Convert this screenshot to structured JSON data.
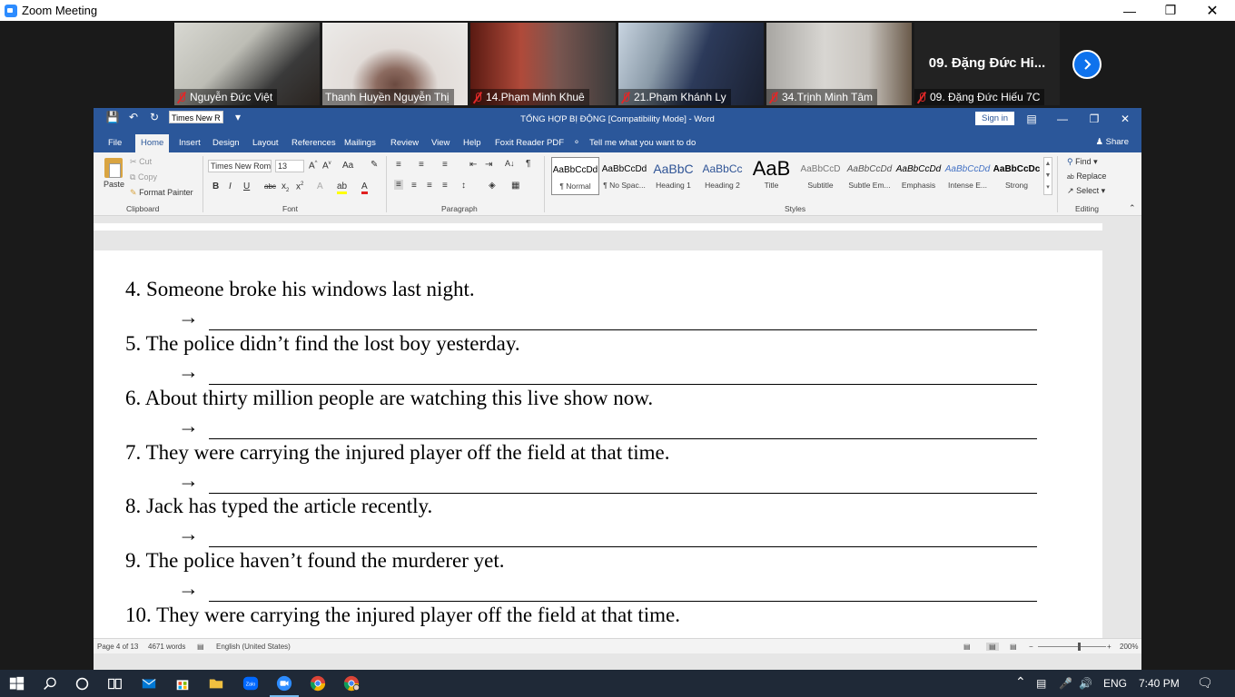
{
  "zoom": {
    "title": "Zoom Meeting",
    "participants": [
      {
        "name": "Nguyễn Đức Việt",
        "muted": true
      },
      {
        "name": "Thanh Huyền Nguyễn Thị",
        "muted": false,
        "active_speaker": true
      },
      {
        "name": "14.Phạm Minh Khuê",
        "muted": true
      },
      {
        "name": "21.Phạm Khánh Ly",
        "muted": true
      },
      {
        "name": "34.Trịnh Minh Tâm",
        "muted": true
      },
      {
        "name": "09. Đặng Đức Hiếu 7C",
        "muted": true,
        "display_name": "09. Đặng Đức Hi..."
      }
    ],
    "next_icon": "chevron-right-icon"
  },
  "word": {
    "qat_font": "Times New R",
    "doc_title": "TỔNG HỢP BỊ ĐỘNG [Compatibility Mode] - Word",
    "sign_in": "Sign in",
    "tabs": [
      "File",
      "Home",
      "Insert",
      "Design",
      "Layout",
      "References",
      "Mailings",
      "Review",
      "View",
      "Help",
      "Foxit Reader PDF"
    ],
    "active_tab": "Home",
    "tell_me": "Tell me what you want to do",
    "share": "Share",
    "clipboard": {
      "paste": "Paste",
      "cut": "Cut",
      "copy": "Copy",
      "format_painter": "Format Painter",
      "label": "Clipboard"
    },
    "font": {
      "name": "Times New Rom",
      "size": "13",
      "label": "Font"
    },
    "paragraph": {
      "label": "Paragraph"
    },
    "styles": {
      "label": "Styles",
      "items": [
        {
          "preview": "AaBbCcDd",
          "name": "¶ Normal"
        },
        {
          "preview": "AaBbCcDd",
          "name": "¶ No Spac..."
        },
        {
          "preview": "AaBbC",
          "name": "Heading 1"
        },
        {
          "preview": "AaBbCc",
          "name": "Heading 2"
        },
        {
          "preview": "AaB",
          "name": "Title"
        },
        {
          "preview": "AaBbCcD",
          "name": "Subtitle"
        },
        {
          "preview": "AaBbCcDd",
          "name": "Subtle Em..."
        },
        {
          "preview": "AaBbCcDd",
          "name": "Emphasis"
        },
        {
          "preview": "AaBbCcDd",
          "name": "Intense E..."
        },
        {
          "preview": "AaBbCcDc",
          "name": "Strong"
        }
      ]
    },
    "editing": {
      "find": "Find",
      "replace": "Replace",
      "select": "Select",
      "label": "Editing"
    },
    "document": {
      "questions": [
        "4. Someone broke his windows last night.",
        "5. The police didn’t find the lost boy yesterday.",
        "6. About thirty million people are watching this live show now.",
        "7. They were carrying the injured player off the field at that time.",
        "8. Jack has typed the article recently.",
        "9. The police haven’t found the murderer yet.",
        "10. They were carrying the injured player off the field at that time."
      ],
      "arrow": "→"
    },
    "status": {
      "page": "Page 4 of 13",
      "words": "4671 words",
      "language": "English (United States)",
      "zoom": "200%"
    }
  },
  "taskbar": {
    "language": "ENG",
    "time": "7:40 PM"
  }
}
